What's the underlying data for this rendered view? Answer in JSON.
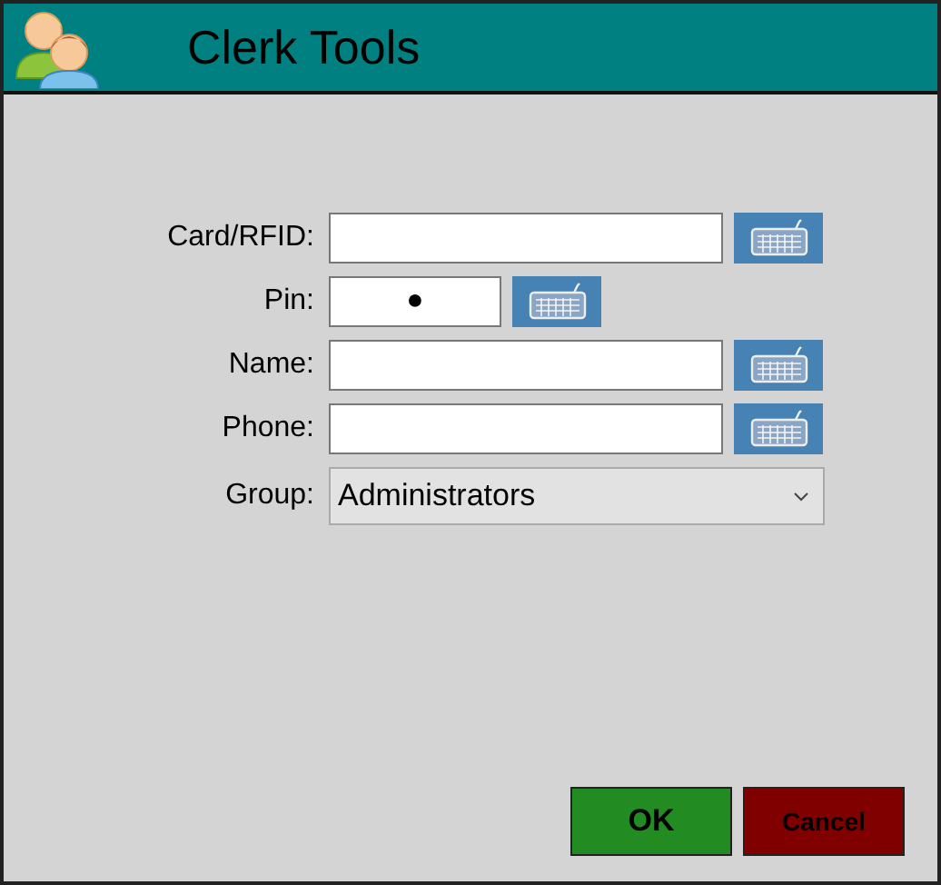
{
  "window": {
    "title": "Clerk Tools"
  },
  "fields": [
    {
      "kind": "text",
      "label": "Card/RFID:"
    },
    {
      "kind": "pin",
      "label": "Pin:",
      "value": "●"
    },
    {
      "kind": "text",
      "label": "Name:"
    },
    {
      "kind": "text",
      "label": "Phone:"
    },
    {
      "kind": "dropdown",
      "label": "Group:",
      "value": "Administrators"
    }
  ],
  "buttons": [
    {
      "kind": "ok",
      "label": "OK"
    },
    {
      "kind": "cancel",
      "label": "Cancel"
    }
  ]
}
